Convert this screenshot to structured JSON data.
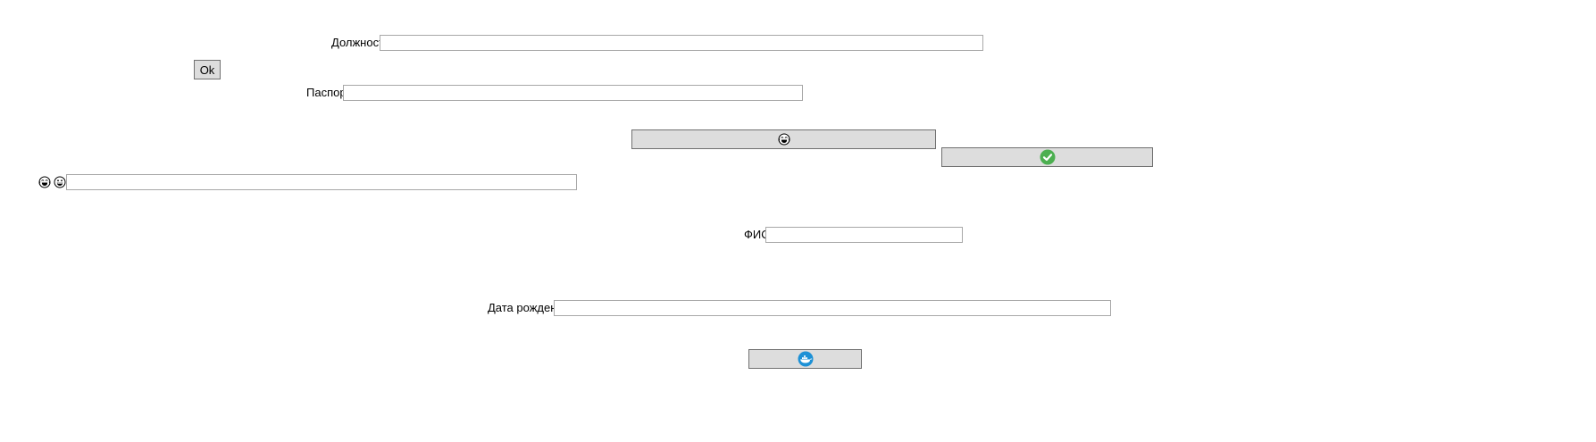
{
  "form": {
    "position": {
      "label": "Должность",
      "value": ""
    },
    "ok_button": {
      "label": "Ok"
    },
    "passport": {
      "label": "Паспорт",
      "value": ""
    },
    "emoji_button": {
      "icon": "grinning-face-with-tears-icon"
    },
    "confirm_button": {
      "icon": "green-check-icon",
      "color": "#4caf50"
    },
    "emoji_field": {
      "icons": [
        "grinning-face-with-tears-icon",
        "grinning-face-icon"
      ],
      "value": ""
    },
    "fio": {
      "label": "ФИО",
      "value": ""
    },
    "birth_date": {
      "label": "Дата рождения",
      "value": ""
    },
    "docker_button": {
      "icon": "docker-whale-icon",
      "color": "#1d91d6"
    }
  }
}
